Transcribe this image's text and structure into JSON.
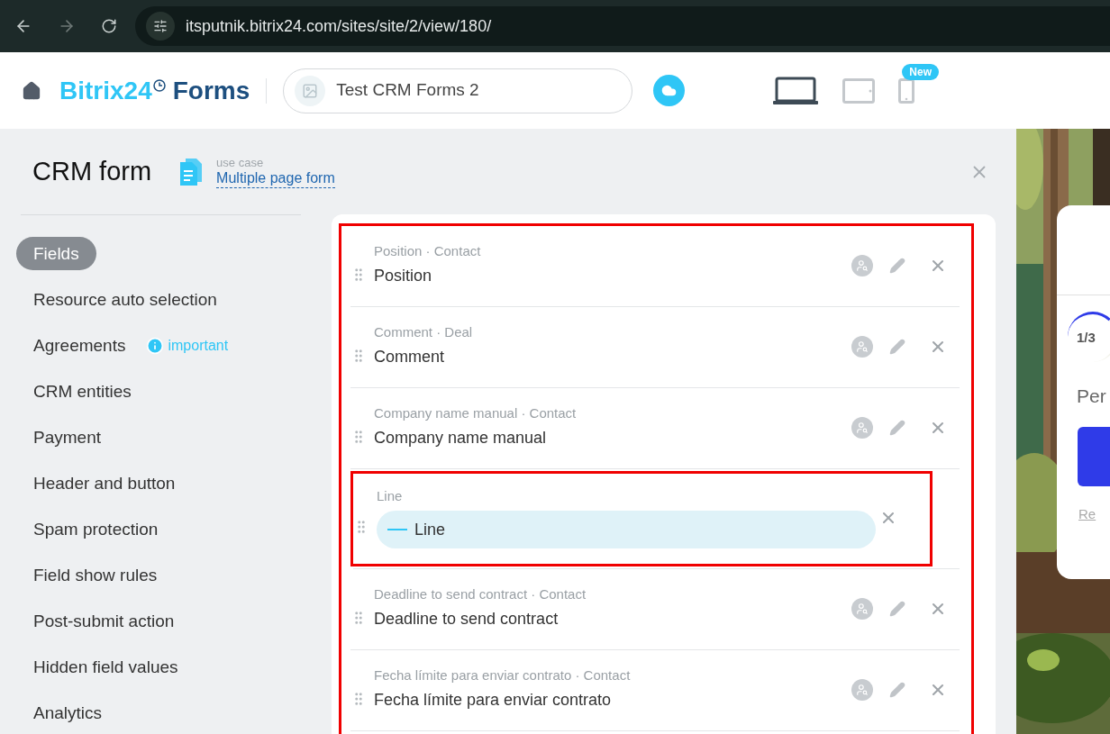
{
  "browser": {
    "url": "itsputnik.bitrix24.com/sites/site/2/view/180/"
  },
  "header": {
    "logo": {
      "brand": "Bitrix24",
      "product": "Forms"
    },
    "form_title": "Test CRM Forms 2",
    "devices": [
      {
        "kind": "laptop",
        "selected": true
      },
      {
        "kind": "tablet",
        "selected": false
      },
      {
        "kind": "phone",
        "selected": false,
        "badge": "New"
      }
    ]
  },
  "page": {
    "title": "CRM form",
    "use_case_label": "use case",
    "use_case": "Multiple page form"
  },
  "sidebar": {
    "items": [
      {
        "label": "Fields",
        "selected": true
      },
      {
        "label": "Resource auto selection",
        "selected": false
      },
      {
        "label": "Agreements",
        "selected": false,
        "note": "important"
      },
      {
        "label": "CRM entities",
        "selected": false
      },
      {
        "label": "Payment",
        "selected": false
      },
      {
        "label": "Header and button",
        "selected": false
      },
      {
        "label": "Spam protection",
        "selected": false
      },
      {
        "label": "Field show rules",
        "selected": false
      },
      {
        "label": "Post-submit action",
        "selected": false
      },
      {
        "label": "Hidden field values",
        "selected": false
      },
      {
        "label": "Analytics",
        "selected": false
      }
    ]
  },
  "fields": {
    "highlighted": true,
    "items": [
      {
        "kind": "field",
        "caption": "Position · Contact",
        "name": "Position",
        "highlighted": false
      },
      {
        "kind": "field",
        "caption": "Comment · Deal",
        "name": "Comment",
        "highlighted": false
      },
      {
        "kind": "field",
        "caption": "Company name manual · Contact",
        "name": "Company name manual",
        "highlighted": false
      },
      {
        "kind": "line",
        "caption": "Line",
        "name": "Line",
        "highlighted": true
      },
      {
        "kind": "field",
        "caption": "Deadline to send contract · Contact",
        "name": "Deadline to send contract",
        "highlighted": false
      },
      {
        "kind": "field",
        "caption": "Fecha límite para enviar contrato · Contact",
        "name": "Fecha límite para enviar contrato",
        "highlighted": false
      }
    ]
  },
  "preview": {
    "step": "1/3",
    "heading": "Per",
    "link": "Re"
  }
}
